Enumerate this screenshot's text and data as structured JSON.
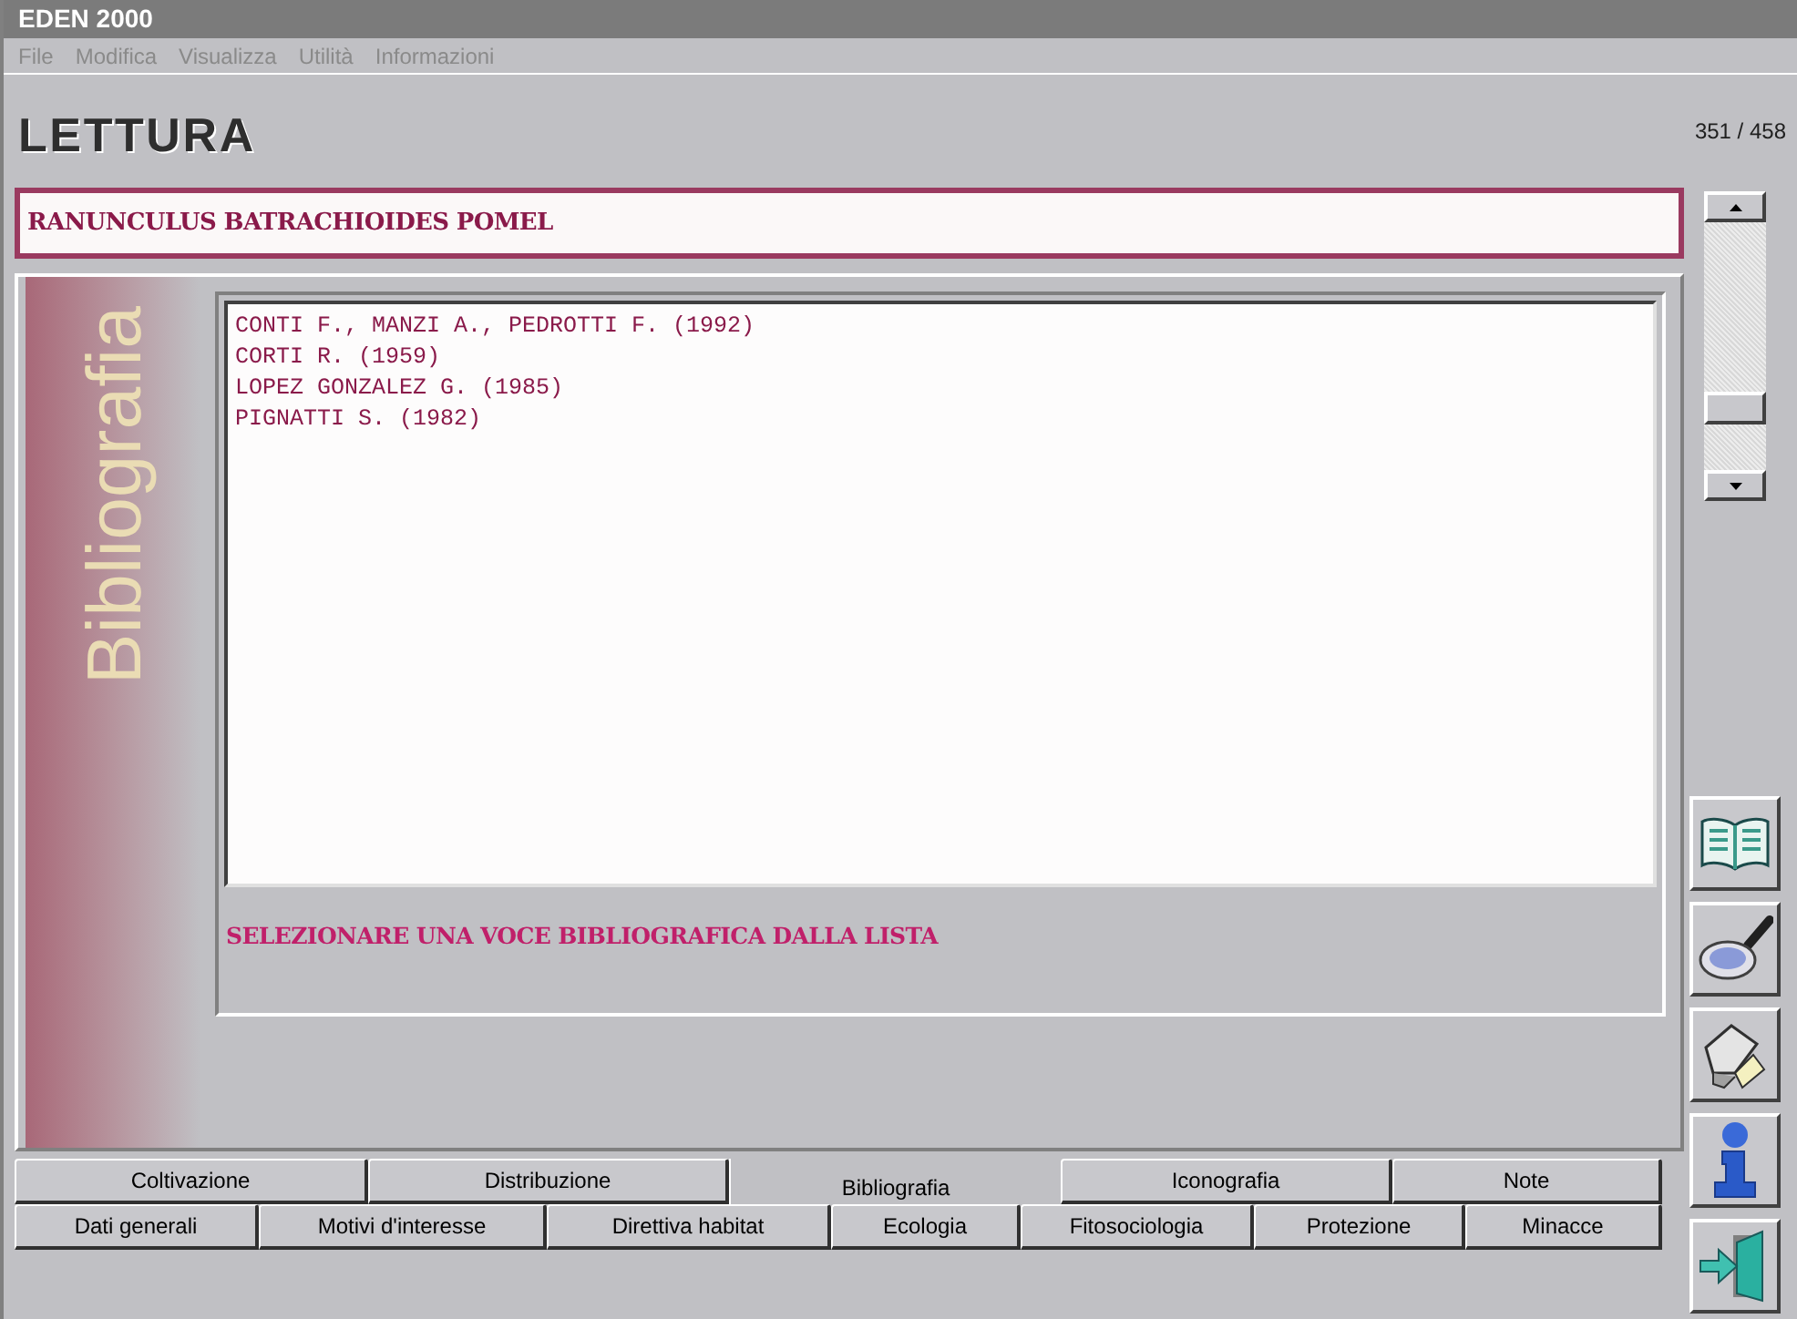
{
  "window": {
    "title": "EDEN 2000"
  },
  "menu": [
    "File",
    "Modifica",
    "Visualizza",
    "Utilità",
    "Informazioni"
  ],
  "heading": "LETTURA",
  "record_counter": "351 / 458",
  "species_name": "RANUNCULUS BATRACHIOIDES POMEL",
  "section_label": "Bibliografia",
  "references": [
    "CONTI F., MANZI A., PEDROTTI F. (1992)",
    "CORTI R. (1959)",
    "LOPEZ GONZALEZ G. (1985)",
    "PIGNATTI S. (1982)"
  ],
  "message": "SELEZIONARE UNA VOCE BIBLIOGRAFICA DALLA LISTA",
  "tabs_top": [
    {
      "label": "Coltivazione",
      "selected": false
    },
    {
      "label": "Distribuzione",
      "selected": false
    },
    {
      "label": "Bibliografia",
      "selected": true
    },
    {
      "label": "Iconografia",
      "selected": false
    },
    {
      "label": "Note",
      "selected": false
    }
  ],
  "tabs_bottom": [
    {
      "label": "Dati generali",
      "selected": false
    },
    {
      "label": "Motivi d'interesse",
      "selected": false
    },
    {
      "label": "Direttiva habitat",
      "selected": false
    },
    {
      "label": "Ecologia",
      "selected": false
    },
    {
      "label": "Fitosociologia",
      "selected": false
    },
    {
      "label": "Protezione",
      "selected": false
    },
    {
      "label": "Minacce",
      "selected": false
    }
  ]
}
